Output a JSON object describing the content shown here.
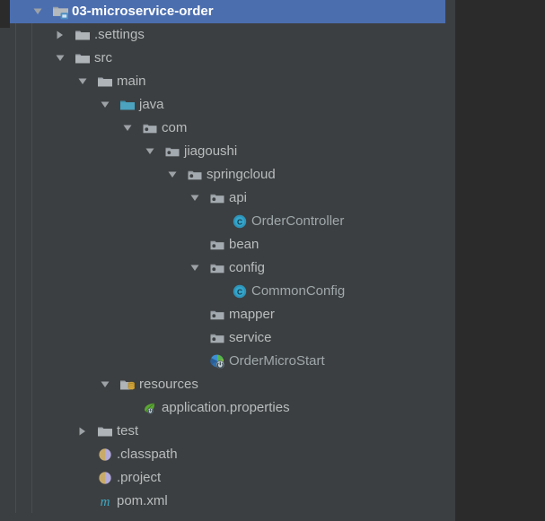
{
  "window": {
    "panel_name": "project-explorer",
    "background": "#3c3f41",
    "editor_background": "#2b2b2b",
    "selection_color": "#4b6eaf",
    "text_color": "#b9bcbd",
    "selected_text_color": "#ffffff"
  },
  "scrollbar": {
    "orientation": "vertical",
    "thumb_color": "#5c5f61"
  },
  "tree": {
    "root_label": "03-microservice-order",
    "nodes": [
      {
        "label": "03-microservice-order",
        "depth": 0,
        "twisty": "expanded",
        "icon": "project-folder-icon",
        "selected": true,
        "type": "project"
      },
      {
        "label": ".settings",
        "depth": 1,
        "twisty": "collapsed",
        "icon": "folder-icon",
        "selected": false,
        "type": "folder"
      },
      {
        "label": "src",
        "depth": 1,
        "twisty": "expanded",
        "icon": "folder-icon",
        "selected": false,
        "type": "folder"
      },
      {
        "label": "main",
        "depth": 2,
        "twisty": "expanded",
        "icon": "folder-icon",
        "selected": false,
        "type": "folder"
      },
      {
        "label": "java",
        "depth": 3,
        "twisty": "expanded",
        "icon": "source-folder-icon",
        "selected": false,
        "type": "source-folder"
      },
      {
        "label": "com",
        "depth": 4,
        "twisty": "expanded",
        "icon": "package-icon",
        "selected": false,
        "type": "package"
      },
      {
        "label": "jiagoushi",
        "depth": 5,
        "twisty": "expanded",
        "icon": "package-icon",
        "selected": false,
        "type": "package"
      },
      {
        "label": "springcloud",
        "depth": 6,
        "twisty": "expanded",
        "icon": "package-icon",
        "selected": false,
        "type": "package"
      },
      {
        "label": "api",
        "depth": 7,
        "twisty": "expanded",
        "icon": "package-icon",
        "selected": false,
        "type": "package"
      },
      {
        "label": "OrderController",
        "depth": 8,
        "twisty": "none",
        "icon": "java-class-icon",
        "selected": false,
        "type": "class"
      },
      {
        "label": "bean",
        "depth": 7,
        "twisty": "none",
        "icon": "package-icon",
        "selected": false,
        "type": "package"
      },
      {
        "label": "config",
        "depth": 7,
        "twisty": "expanded",
        "icon": "package-icon",
        "selected": false,
        "type": "package"
      },
      {
        "label": "CommonConfig",
        "depth": 8,
        "twisty": "none",
        "icon": "java-class-icon",
        "selected": false,
        "type": "class"
      },
      {
        "label": "mapper",
        "depth": 7,
        "twisty": "none",
        "icon": "package-icon",
        "selected": false,
        "type": "package"
      },
      {
        "label": "service",
        "depth": 7,
        "twisty": "none",
        "icon": "package-icon",
        "selected": false,
        "type": "package"
      },
      {
        "label": "OrderMicroStart",
        "depth": 7,
        "twisty": "none",
        "icon": "spring-boot-app-icon",
        "selected": false,
        "type": "spring-boot-class"
      },
      {
        "label": "resources",
        "depth": 3,
        "twisty": "expanded",
        "icon": "resources-folder-icon",
        "selected": false,
        "type": "resource-folder"
      },
      {
        "label": "application.properties",
        "depth": 4,
        "twisty": "none",
        "icon": "properties-file-icon",
        "selected": false,
        "type": "properties"
      },
      {
        "label": "test",
        "depth": 2,
        "twisty": "collapsed",
        "icon": "folder-icon",
        "selected": false,
        "type": "folder"
      },
      {
        "label": ".classpath",
        "depth": 2,
        "twisty": "none",
        "icon": "classpath-file-icon",
        "selected": false,
        "type": "file"
      },
      {
        "label": ".project",
        "depth": 2,
        "twisty": "none",
        "icon": "project-file-icon",
        "selected": false,
        "type": "file"
      },
      {
        "label": "pom.xml",
        "depth": 2,
        "twisty": "none",
        "icon": "maven-pom-icon",
        "selected": false,
        "type": "file"
      }
    ]
  }
}
